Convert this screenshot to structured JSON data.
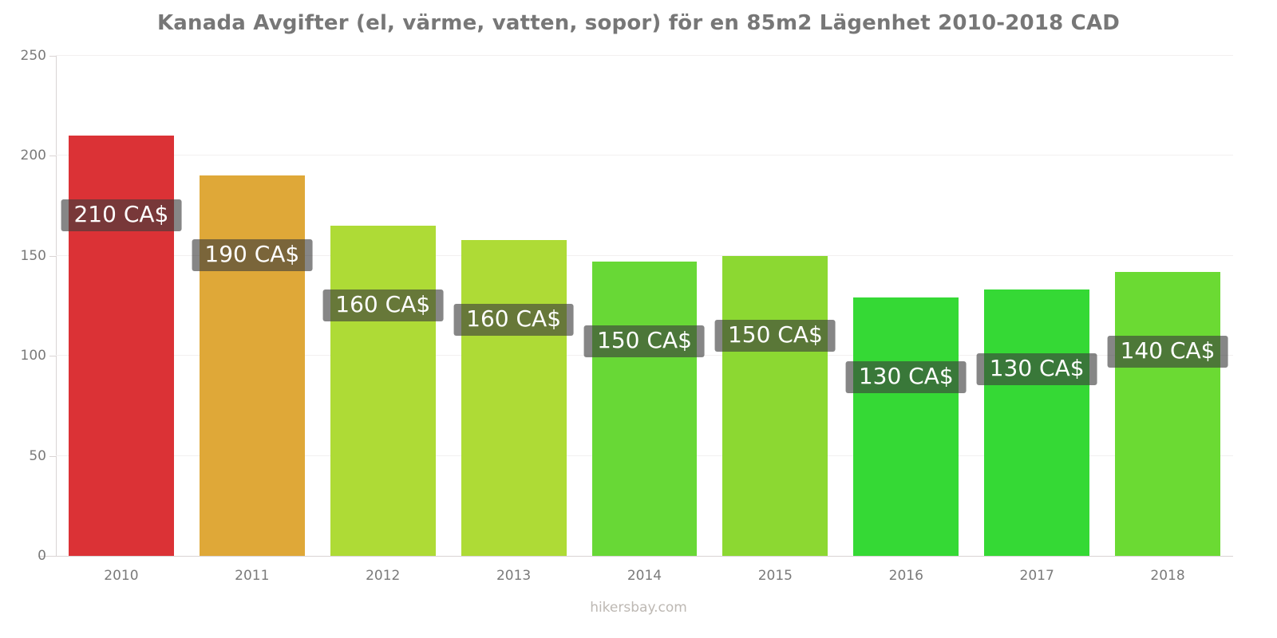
{
  "chart_data": {
    "type": "bar",
    "title": "Kanada Avgifter (el, värme, vatten, sopor) för en 85m2 Lägenhet 2010-2018 CAD",
    "xlabel": "",
    "ylabel": "",
    "categories": [
      "2010",
      "2011",
      "2012",
      "2013",
      "2014",
      "2015",
      "2016",
      "2017",
      "2018"
    ],
    "values": [
      210,
      190,
      165,
      158,
      147,
      150,
      129,
      133,
      142
    ],
    "data_labels": [
      "210 CA$",
      "190 CA$",
      "160 CA$",
      "160 CA$",
      "150 CA$",
      "150 CA$",
      "130 CA$",
      "130 CA$",
      "140 CA$"
    ],
    "bar_colors": [
      "#DB3236",
      "#DFA838",
      "#AEDB36",
      "#AEDB36",
      "#68D836",
      "#8CD832",
      "#35D935",
      "#35D935",
      "#6BDA33"
    ],
    "ylim": [
      0,
      250
    ],
    "yticks": [
      0,
      50,
      100,
      150,
      200,
      250
    ],
    "ytick_labels": [
      "0",
      "50",
      "100",
      "150",
      "200",
      "250"
    ],
    "grid": true,
    "legend": "none",
    "currency": "CAD"
  },
  "footer": {
    "credit": "hikersbay.com"
  },
  "colors": {
    "title_text": "#777777",
    "tick_text": "#7a7a7a",
    "axis_line": "#d9d4d4",
    "grid_line": "#f2f0f0",
    "label_text": "#ffffff",
    "footer_text": "#bdb8b3"
  }
}
